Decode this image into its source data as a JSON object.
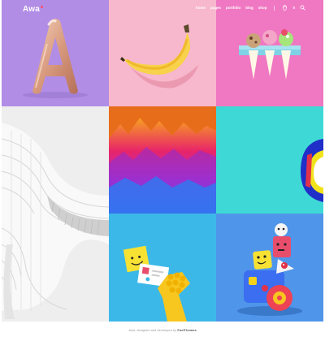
{
  "header": {
    "logo": "Awa",
    "nav": [
      "home",
      "pages",
      "portfolio",
      "blog",
      "shop"
    ],
    "cart_count": "0"
  },
  "tiles": {
    "t1": {
      "icon": "balloon-letter-a"
    },
    "t2": {
      "icon": "banana"
    },
    "t3": {
      "icon": "ice-cream-cones"
    },
    "t4": {
      "icon": "white-building"
    },
    "t5": {
      "icon": "gradient-mountains"
    },
    "t6": {
      "icon": "sneaker"
    },
    "t7": {
      "icon": "yellow-hand-card"
    },
    "t8": {
      "icon": "toy-robot-stack"
    }
  },
  "footer": {
    "text_pre": "Awa, designed and developed by",
    "brand": "FuelThemes"
  },
  "colors": {
    "purple": "#b18de6",
    "pink": "#f7b7cc",
    "magenta": "#f077c2",
    "teal": "#3ed9d6",
    "blue": "#4f95ea",
    "sky": "#3cb8e8"
  }
}
